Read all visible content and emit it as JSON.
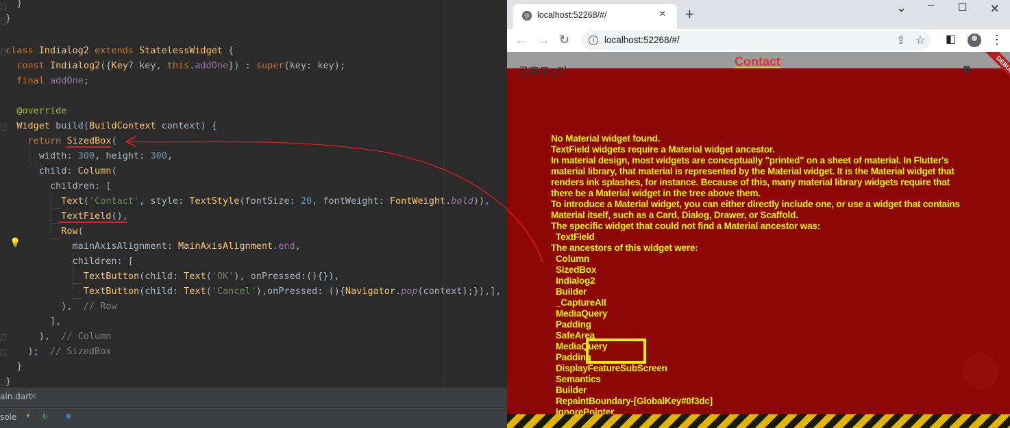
{
  "ide": {
    "code_lines": [
      {
        "text": "  }"
      },
      {
        "text": "}"
      },
      {
        "text": ""
      },
      {
        "text": "class Indialog2 extends StatelessWidget {"
      },
      {
        "text": "  const Indialog2({Key? key, this.addOne}) : super(key: key);"
      },
      {
        "text": "  final addOne;"
      },
      {
        "text": ""
      },
      {
        "text": "  @override"
      },
      {
        "text": "  Widget build(BuildContext context) {"
      },
      {
        "text": "    return SizedBox("
      },
      {
        "text": "      width: 300, height: 300,"
      },
      {
        "text": "      child: Column("
      },
      {
        "text": "        children: ["
      },
      {
        "text": "          Text('Contact', style: TextStyle(fontSize: 20, fontWeight: FontWeight.bold)),"
      },
      {
        "text": "          TextField(),"
      },
      {
        "text": "          Row("
      },
      {
        "text": "            mainAxisAlignment: MainAxisAlignment.end,"
      },
      {
        "text": "            children: ["
      },
      {
        "text": "              TextButton(child: Text('OK'), onPressed:(){}),"
      },
      {
        "text": "              TextButton(child: Text('Cancel'),onPressed: (){Navigator.pop(context);}),],"
      },
      {
        "text": "          ),  // Row"
      },
      {
        "text": "        ],"
      },
      {
        "text": "      ),  // Column"
      },
      {
        "text": "    );  // SizedBox"
      },
      {
        "text": "  }"
      },
      {
        "text": "}"
      }
    ],
    "file_tab": "ain.dart",
    "file_tab_close": "×",
    "console_label": "sole"
  },
  "browser": {
    "tab_title": "localhost:52268/#/",
    "tab_close": "×",
    "new_tab": "+",
    "url": "localhost:52268/#/",
    "window_controls": {
      "minimize": "⌄",
      "restore": "–",
      "maximize": "☐",
      "close": "✕"
    }
  },
  "app": {
    "appbar_title": "금혼도2기",
    "contact_text": "Contact",
    "debug_banner": "DEBUG",
    "error_lines": [
      "No Material widget found.",
      "TextField widgets require a Material widget ancestor.",
      "In material design, most widgets are conceptually \"printed\" on a sheet of material. In Flutter's",
      "material library, that material is represented by the Material widget. It is the Material widget that",
      "renders ink splashes, for instance. Because of this, many material library widgets require that",
      "there be a Material widget in the tree above them.",
      "To introduce a Material widget, you can either directly include one, or use a widget that contains",
      "Material itself, such as a Card, Dialog, Drawer, or Scaffold.",
      "The specific widget that could not find a Material ancestor was:"
    ],
    "widget_name": "TextField",
    "ancestors_header": "The ancestors of this widget were:",
    "ancestors": [
      "Column",
      "SizedBox",
      "Indialog2",
      "Builder",
      "_CaptureAll",
      "MediaQuery",
      "Padding",
      "SafeArea",
      "MediaQuery",
      "Padding",
      "DisplayFeatureSubScreen",
      "Semantics",
      "Builder",
      "RepaintBoundary-[GlobalKey#0f3dc]",
      "IgnorePointer"
    ],
    "colors": {
      "error_background": "#8e0707",
      "error_text": "#f2f200",
      "highlight_box": "#eded00",
      "annotation_arrow": "#e02020"
    }
  }
}
